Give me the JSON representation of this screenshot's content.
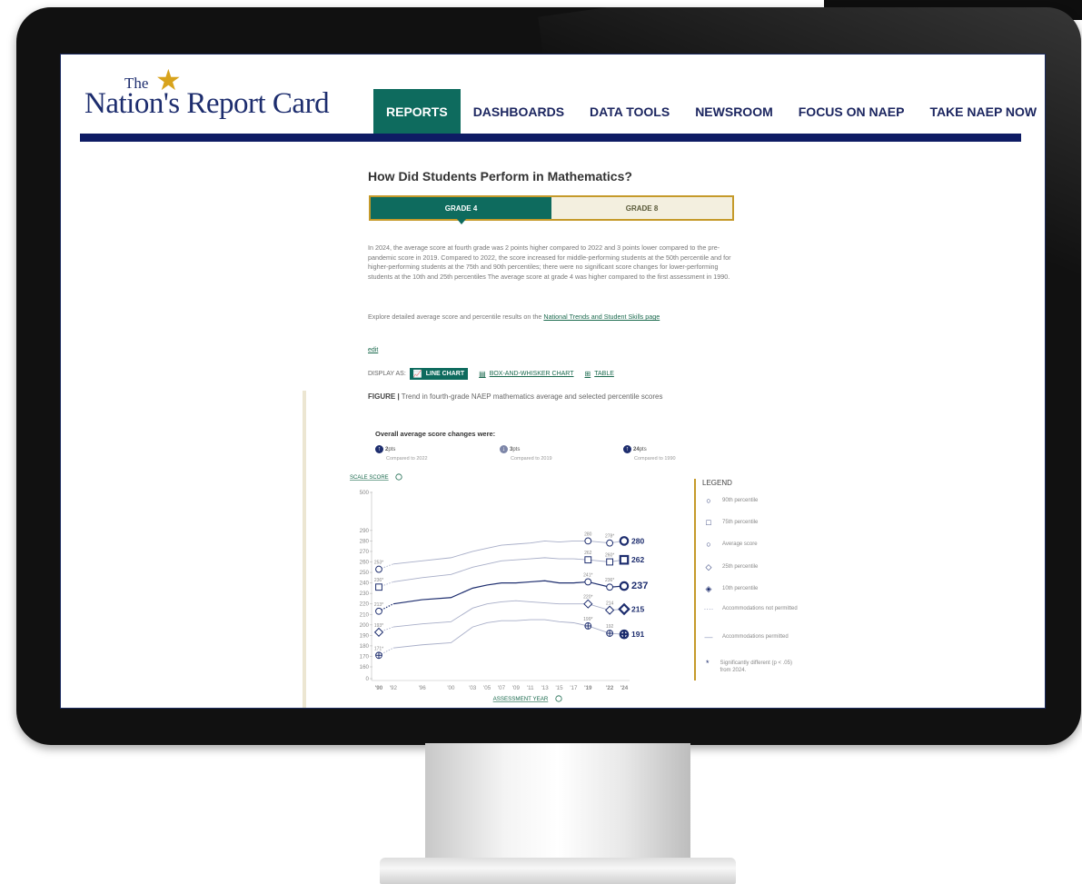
{
  "site": {
    "logo_the": "The",
    "logo_main": "Nation's Report Card",
    "nav": [
      {
        "label": "REPORTS",
        "active": true
      },
      {
        "label": "DASHBOARDS"
      },
      {
        "label": "DATA TOOLS"
      },
      {
        "label": "NEWSROOM"
      },
      {
        "label": "FOCUS ON NAEP"
      },
      {
        "label": "TAKE NAEP NOW"
      }
    ]
  },
  "page": {
    "title": "How Did Students Perform in Mathematics?",
    "tabs": [
      {
        "label": "GRADE 4",
        "active": true
      },
      {
        "label": "GRADE 8"
      }
    ],
    "paragraph": "In 2024, the average score at fourth grade was 2 points higher compared to 2022 and 3 points lower compared to the pre-pandemic score in 2019. Compared to 2022, the score increased for middle-performing students at the 50th percentile and for higher-performing students at the 75th and 90th percentiles; there were no significant score changes for lower-performing students at the 10th and 25th percentiles The average score at grade 4 was higher compared to the first assessment in 1990.",
    "explore_prefix": "Explore detailed average score and percentile results on the ",
    "explore_link": "National Trends and Student Skills page",
    "edit": "edit",
    "display_as": "DISPLAY AS:",
    "display_options": [
      "LINE CHART",
      "BOX-AND-WHISKER CHART",
      "TABLE"
    ],
    "figure_label": "FIGURE |",
    "figure_title": "Trend in fourth-grade NAEP mathematics average and selected percentile scores",
    "overall_label": "Overall average score changes were:",
    "changes": [
      {
        "value": "2",
        "unit": "pts",
        "direction": "up",
        "sub": "Compared to 2022"
      },
      {
        "value": "3",
        "unit": "pts",
        "direction": "down",
        "sub": "Compared to 2019"
      },
      {
        "value": "24",
        "unit": "pts",
        "direction": "up",
        "sub": "Compared to 1990"
      }
    ]
  },
  "legend": {
    "title": "LEGEND",
    "items": [
      {
        "label": "90th percentile",
        "icon": "circle-icon"
      },
      {
        "label": "75th percentile",
        "icon": "square-icon"
      },
      {
        "label": "Average score",
        "icon": "circle-icon"
      },
      {
        "label": "25th percentile",
        "icon": "diamond-icon"
      },
      {
        "label": "10th percentile",
        "icon": "diamond-cross-icon"
      },
      {
        "label": "Accommodations not permitted",
        "icon": "dotted-line-icon"
      },
      {
        "label": "Accommodations permitted",
        "icon": "solid-line-icon"
      },
      {
        "label": "Significantly different (p < .05) from 2024.",
        "icon": "asterisk-icon"
      }
    ]
  },
  "colors": {
    "brand_navy": "#1d2d6e",
    "accent_green": "#0e6b5e",
    "gold": "#c59a2a"
  },
  "chart_data": {
    "type": "line",
    "ylabel": "SCALE SCORE",
    "xlabel": "ASSESSMENT YEAR",
    "ylim": [
      0,
      300
    ],
    "y_ticks": [
      "0",
      "160",
      "170",
      "180",
      "190",
      "200",
      "210",
      "220",
      "230",
      "240",
      "250",
      "260",
      "270",
      "280",
      "290",
      "500"
    ],
    "x": [
      "'90",
      "'92",
      "'96",
      "'00",
      "'03",
      "'05",
      "'07",
      "'09",
      "'11",
      "'13",
      "'15",
      "'17",
      "'19",
      "'22",
      "'24"
    ],
    "x_years": [
      1990,
      1992,
      1996,
      2000,
      2003,
      2005,
      2007,
      2009,
      2011,
      2013,
      2015,
      2017,
      2019,
      2022,
      2024
    ],
    "series": [
      {
        "name": "90th percentile",
        "values": [
          253,
          258,
          261,
          264,
          270,
          273,
          276,
          277,
          278,
          280,
          279,
          280,
          280,
          278,
          280
        ],
        "labels": {
          "0": "253*",
          "12": "280",
          "13": "278*",
          "14": "280"
        }
      },
      {
        "name": "75th percentile",
        "values": [
          236,
          241,
          245,
          248,
          255,
          258,
          261,
          262,
          263,
          264,
          263,
          263,
          262,
          260,
          262
        ],
        "labels": {
          "0": "236*",
          "12": "262",
          "13": "260*",
          "14": "262"
        }
      },
      {
        "name": "Average score",
        "values": [
          213,
          220,
          224,
          226,
          235,
          238,
          240,
          240,
          241,
          242,
          240,
          240,
          241,
          236,
          237
        ],
        "labels": {
          "0": "213*",
          "12": "241*",
          "13": "236*",
          "14": "237"
        }
      },
      {
        "name": "25th percentile",
        "values": [
          193,
          198,
          201,
          203,
          216,
          220,
          222,
          223,
          222,
          221,
          220,
          220,
          220,
          214,
          215
        ],
        "labels": {
          "0": "193*",
          "12": "220*",
          "13": "214",
          "14": "215"
        }
      },
      {
        "name": "10th percentile",
        "values": [
          171,
          178,
          181,
          183,
          198,
          202,
          204,
          204,
          205,
          205,
          203,
          202,
          199,
          192,
          191
        ],
        "labels": {
          "0": "171*",
          "12": "199*",
          "13": "192",
          "14": "191"
        }
      }
    ]
  }
}
